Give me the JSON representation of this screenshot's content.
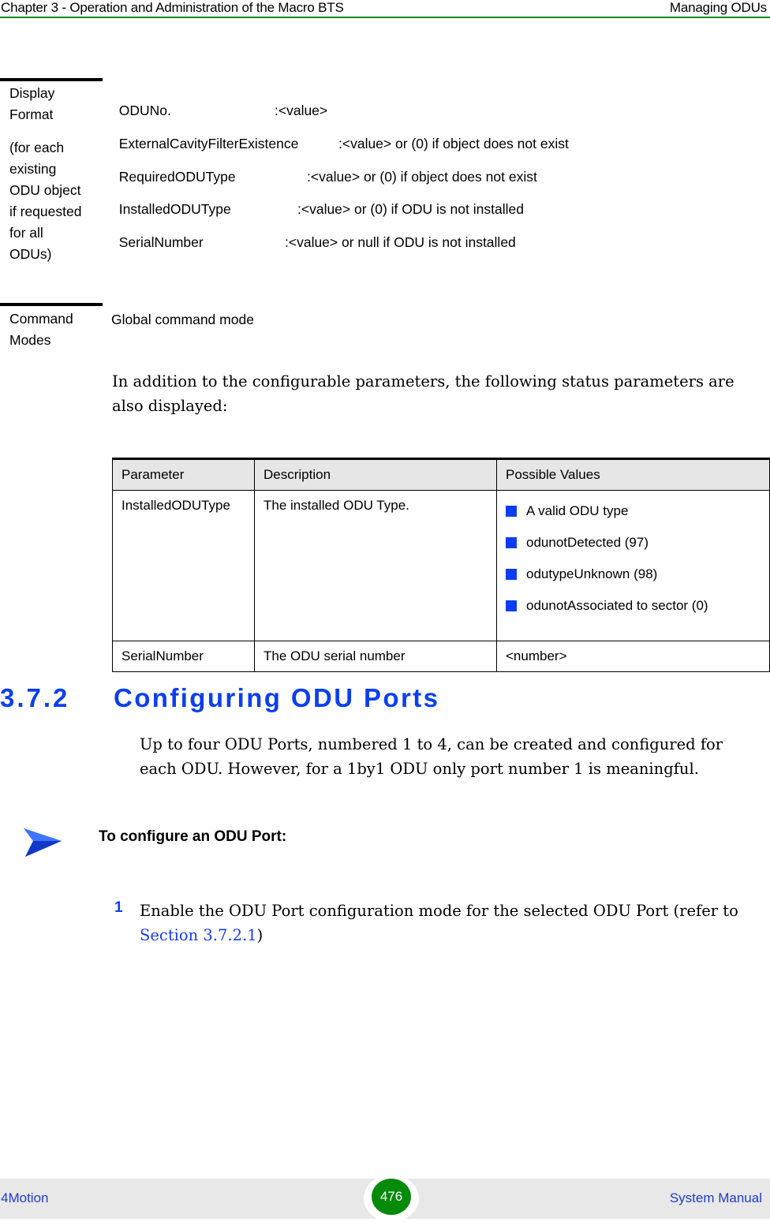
{
  "header": {
    "chapter": "Chapter 3 - Operation and Administration of the Macro BTS",
    "section": "Managing ODUs"
  },
  "display_format": {
    "label_lines": [
      "Display",
      "Format"
    ],
    "sub_label_lines": [
      "(for each",
      "existing",
      "ODU object",
      "if requested",
      "for all",
      "ODUs)"
    ],
    "lines": [
      {
        "name": "ODUNo.",
        "value": ":<value>"
      },
      {
        "name": "ExternalCavityFilterExistence",
        "value": ":<value> or (0) if object does not exist"
      },
      {
        "name": "RequiredODUType",
        "value": ":<value> or (0) if object does not exist"
      },
      {
        "name": "InstalledODUType",
        "value": ":<value> or (0) if ODU is not installed"
      },
      {
        "name": "SerialNumber",
        "value": ":<value> or null if ODU is not installed"
      }
    ]
  },
  "command_modes": {
    "label_lines": [
      "Command",
      "Modes"
    ],
    "value": "Global command mode"
  },
  "intro_paragraph": "In addition to the configurable parameters, the following status parameters are also displayed:",
  "status_table": {
    "headers": [
      "Parameter",
      "Description",
      "Possible Values"
    ],
    "rows": [
      {
        "parameter": "InstalledODUType",
        "description": "The installed ODU Type.",
        "values": [
          "A valid ODU type",
          "odunotDetected (97)",
          "odutypeUnknown (98)",
          "odunotAssociated to sector (0)"
        ]
      },
      {
        "parameter": "SerialNumber",
        "description": "The ODU serial number",
        "value_text": "<number>"
      }
    ]
  },
  "section": {
    "number": "3.7.2",
    "title": "Configuring ODU Ports",
    "paragraph": "Up to four ODU Ports, numbered 1 to 4, can be created and configured for each ODU. However, for a 1by1 ODU only port number 1 is meaningful."
  },
  "procedure": {
    "icon": "arrow-right-icon",
    "title": "To configure an ODU Port:",
    "steps": [
      {
        "number": "1",
        "text": "Enable the ODU Port configuration mode for the selected ODU Port (refer to ",
        "link": "Section 3.7.2.1",
        "suffix": ")"
      }
    ]
  },
  "footer": {
    "product": "4Motion",
    "page": "476",
    "doc": "System Manual"
  },
  "colors": {
    "header_rule": "#168a16",
    "heading_blue": "#0b3ff0",
    "bullet_blue": "#0a3cf5",
    "page_badge": "#058a0a",
    "footer_bg": "#e8e8e8",
    "footer_text": "#1f3bd6"
  }
}
